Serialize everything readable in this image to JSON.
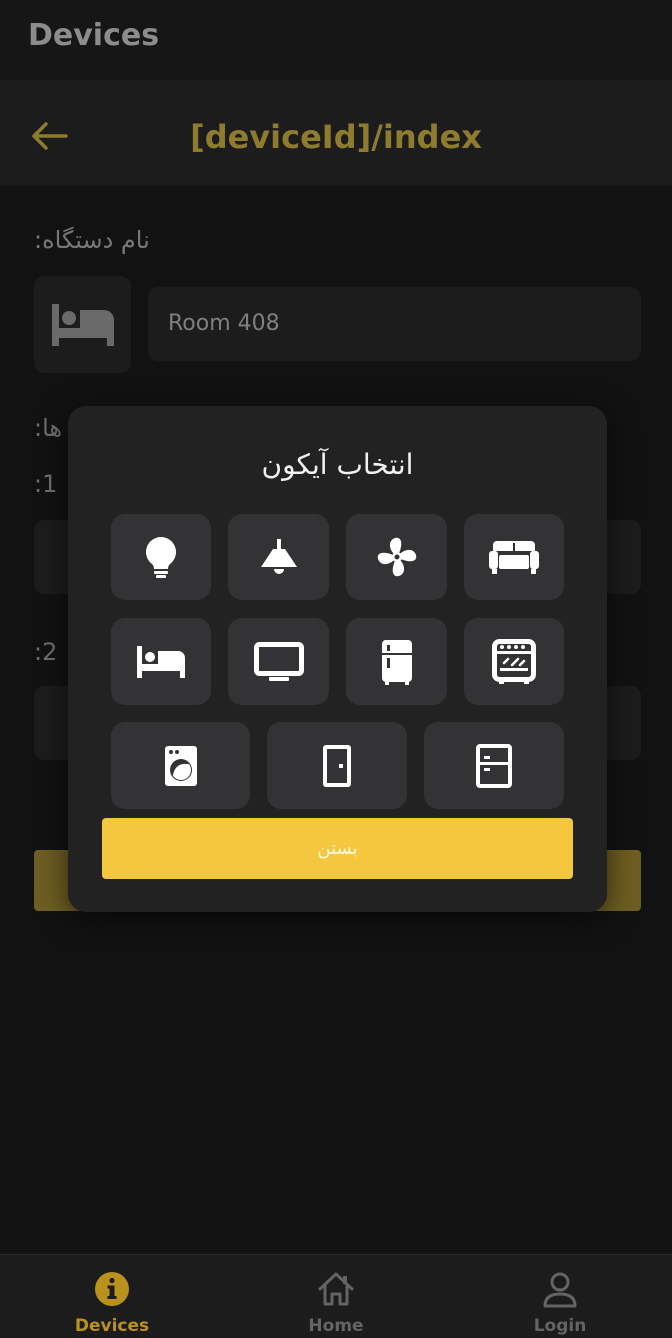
{
  "app": {
    "title": "Devices"
  },
  "header": {
    "title": "[deviceId]/index",
    "back_icon": "arrow-left-icon"
  },
  "form": {
    "name_label": "نام دستگاه:",
    "selected_icon": "bed-icon",
    "name_value": "Room 408",
    "items_label": "ها:",
    "item1_label": ":1",
    "item2_label": ":2"
  },
  "modal": {
    "title": "انتخاب آیکون",
    "icons": [
      "lightbulb-icon",
      "ceiling-lamp-icon",
      "fan-icon",
      "sofa-icon",
      "bed-icon",
      "tv-icon",
      "fridge-icon",
      "oven-icon",
      "washing-machine-icon",
      "door-icon",
      "cabinet-icon"
    ],
    "close_label": "بستن"
  },
  "nav": {
    "items": [
      {
        "label": "Devices",
        "icon": "info-icon",
        "active": true
      },
      {
        "label": "Home",
        "icon": "home-icon",
        "active": false
      },
      {
        "label": "Login",
        "icon": "user-icon",
        "active": false
      }
    ]
  },
  "colors": {
    "accent": "#f4c73f",
    "accent_dim": "#8f7b2e",
    "background": "#121213",
    "surface": "#1c1c1d",
    "modal": "#222223",
    "tile": "#333335"
  }
}
